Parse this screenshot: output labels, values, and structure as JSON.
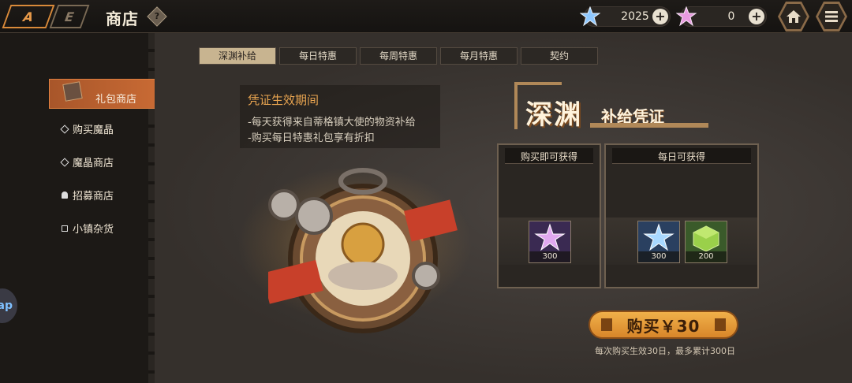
{
  "header": {
    "logo_left": "A",
    "logo_right": "E",
    "title": "商店",
    "help": "?",
    "currencies": [
      {
        "name": "blue-crystal",
        "amount": "2025",
        "color": "#7ab8ff"
      },
      {
        "name": "pink-crystal",
        "amount": "0",
        "color": "#e08ad8"
      }
    ],
    "plus": "+",
    "home_icon": "home-icon",
    "menu_icon": "menu-icon"
  },
  "sidebar": {
    "active": {
      "label": "礼包商店",
      "icon": "gift-box-icon"
    },
    "items": [
      {
        "label": "购买魔晶",
        "icon": "diamond-icon"
      },
      {
        "label": "魔晶商店",
        "icon": "diamond-icon"
      },
      {
        "label": "招募商店",
        "icon": "bell-icon"
      },
      {
        "label": "小镇杂货",
        "icon": "square-icon"
      }
    ],
    "tap_label": "ap"
  },
  "tabs": [
    {
      "label": "深渊补给",
      "active": true
    },
    {
      "label": "每日特惠",
      "active": false
    },
    {
      "label": "每周特惠",
      "active": false
    },
    {
      "label": "每月特惠",
      "active": false
    },
    {
      "label": "契约",
      "active": false
    }
  ],
  "period": {
    "title": "凭证生效期间",
    "lines": [
      "-每天获得来自蒂格镇大使的物资补给",
      "-购买每日特惠礼包享有折扣"
    ]
  },
  "product": {
    "title_main": "深渊",
    "title_sub": "补给凭证",
    "panels": [
      {
        "header": "购买即可获得",
        "items": [
          {
            "icon": "pink-crystal-icon",
            "qty": "300"
          }
        ]
      },
      {
        "header": "每日可获得",
        "items": [
          {
            "icon": "blue-crystal-icon",
            "qty": "300"
          },
          {
            "icon": "green-cube-icon",
            "qty": "200"
          }
        ]
      }
    ],
    "buy_label": "购买￥30",
    "buy_note": "每次购买生效30日，最多累计300日"
  }
}
